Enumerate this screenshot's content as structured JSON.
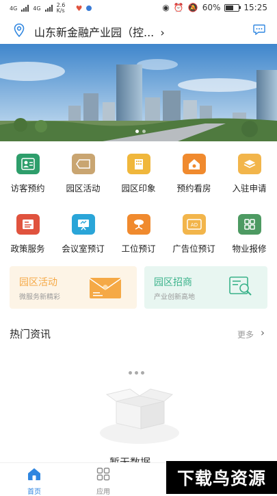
{
  "status": {
    "net1": "4G",
    "net2": "4G",
    "speed": "2.6 K/s",
    "battery_pct": "60%",
    "battery_level": 0.6,
    "time": "15:25"
  },
  "header": {
    "title": "山东新金融产业园（控...",
    "location_icon": "location-pin-icon",
    "message_icon": "message-icon"
  },
  "banner": {
    "page_count": 2,
    "active_page": 1
  },
  "grid": [
    {
      "label": "访客预约",
      "icon": "visitor-icon",
      "color": "#2e9e6b"
    },
    {
      "label": "园区活动",
      "icon": "tag-icon",
      "color": "#c9a571"
    },
    {
      "label": "园区印象",
      "icon": "building-icon",
      "color": "#f0b73c"
    },
    {
      "label": "预约看房",
      "icon": "house-icon",
      "color": "#f08a2e"
    },
    {
      "label": "入驻申请",
      "icon": "stack-icon",
      "color": "#f2b54b"
    },
    {
      "label": "政策服务",
      "icon": "document-icon",
      "color": "#e0533e"
    },
    {
      "label": "会议室预订",
      "icon": "presentation-icon",
      "color": "#2aa5d8"
    },
    {
      "label": "工位预订",
      "icon": "desk-chair-icon",
      "color": "#f08a2e"
    },
    {
      "label": "广告位预订",
      "icon": "ad-icon",
      "color": "#f2b54b"
    },
    {
      "label": "物业报修",
      "icon": "grid-apps-icon",
      "color": "#4d9a62"
    }
  ],
  "cards": [
    {
      "title": "园区活动",
      "subtitle": "微服务新精彩",
      "bg": "#fdf4e6",
      "accent": "#f5a946",
      "icon": "envelope-icon"
    },
    {
      "title": "园区招商",
      "subtitle": "产业创新高地",
      "bg": "#e8f6f1",
      "accent": "#3ab28a",
      "icon": "search-document-icon"
    }
  ],
  "news": {
    "title": "热门资讯",
    "more": "更多",
    "chevron": "›",
    "empty_text": "暂无数据"
  },
  "tabbar": [
    {
      "label": "首页",
      "icon": "home-icon",
      "active": true
    },
    {
      "label": "应用",
      "icon": "apps-icon",
      "active": false
    }
  ],
  "watermark": "下载鸟资源",
  "colors": {
    "accent": "#2f86e0",
    "tab_inactive": "#888888"
  }
}
